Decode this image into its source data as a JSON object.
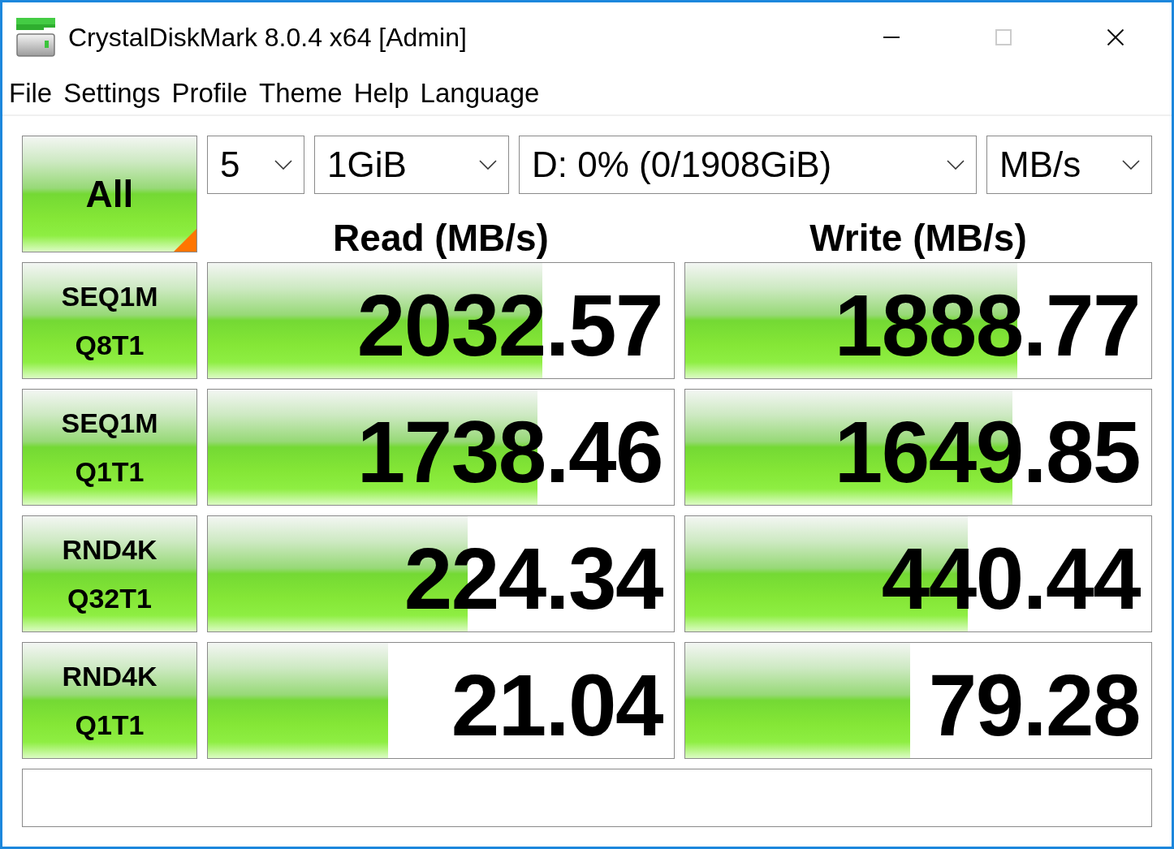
{
  "window": {
    "title": "CrystalDiskMark 8.0.4 x64 [Admin]",
    "controls": [
      {
        "kind": "minimize",
        "disabled": false
      },
      {
        "kind": "maximize",
        "disabled": true
      },
      {
        "kind": "close",
        "disabled": false
      }
    ]
  },
  "menu": [
    {
      "label": "File"
    },
    {
      "label": "Settings"
    },
    {
      "label": "Profile"
    },
    {
      "label": "Theme"
    },
    {
      "label": "Help"
    },
    {
      "label": "Language"
    }
  ],
  "all_button": {
    "label": "All"
  },
  "selectors": [
    {
      "value": "5"
    },
    {
      "value": "1GiB"
    },
    {
      "value": "D: 0% (0/1908GiB)"
    },
    {
      "value": "MB/s"
    }
  ],
  "columns": [
    {
      "label": "Read (MB/s)"
    },
    {
      "label": "Write (MB/s)"
    }
  ],
  "tests": [
    {
      "label": [
        "SEQ1M",
        "Q8T1"
      ],
      "read": {
        "value": "2032.57",
        "level": 0.718
      },
      "write": {
        "value": "1888.77",
        "level": 0.713
      }
    },
    {
      "label": [
        "SEQ1M",
        "Q1T1"
      ],
      "read": {
        "value": "1738.46",
        "level": 0.707
      },
      "write": {
        "value": "1649.85",
        "level": 0.702
      }
    },
    {
      "label": [
        "RND4K",
        "Q32T1"
      ],
      "read": {
        "value": "224.34",
        "level": 0.557
      },
      "write": {
        "value": "440.44",
        "level": 0.606
      }
    },
    {
      "label": [
        "RND4K",
        "Q1T1"
      ],
      "read": {
        "value": "21.04",
        "level": 0.387
      },
      "write": {
        "value": "79.28",
        "level": 0.483
      }
    }
  ]
}
